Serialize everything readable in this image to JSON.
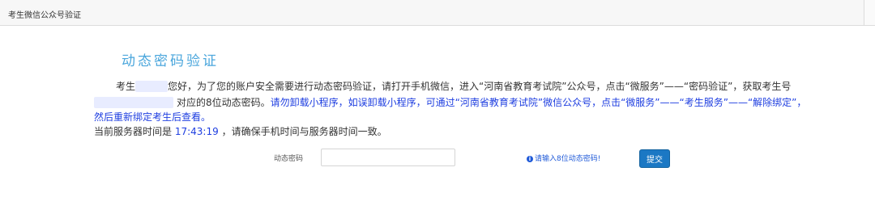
{
  "topbar": {
    "title": "考生微信公众号验证"
  },
  "heading": "动态密码验证",
  "message": {
    "line1_prefix": "考生",
    "line1_text": "您好，为了您的账户安全需要进行动态密码验证，请打开手机微信，进入“河南省教育考试院”公众号，点击“微服务”——“密码验证”，获取考生号",
    "line2_text": "对应的8位动态密码。",
    "line2_blue": "请勿卸载小程序，如误卸载小程序，可通过“河南省教育考试院”微信公众号，点击“微服务”——“考生服务”——“解除绑定”，",
    "line3_blue": "然后重新绑定考生后查看。",
    "server_prefix": "当前服务器时间是",
    "server_time": "17:43:19",
    "server_suffix": "，请确保手机时间与服务器时间一致。"
  },
  "form": {
    "label": "动态密码",
    "input_value": "",
    "hint": "请输入8位动态密码!",
    "submit_label": "提交"
  },
  "colors": {
    "heading": "#4aa6dc",
    "link_text": "#1e3ee0",
    "button": "#1b78c4"
  },
  "icons": {
    "hint_icon": "info-circle-icon"
  }
}
